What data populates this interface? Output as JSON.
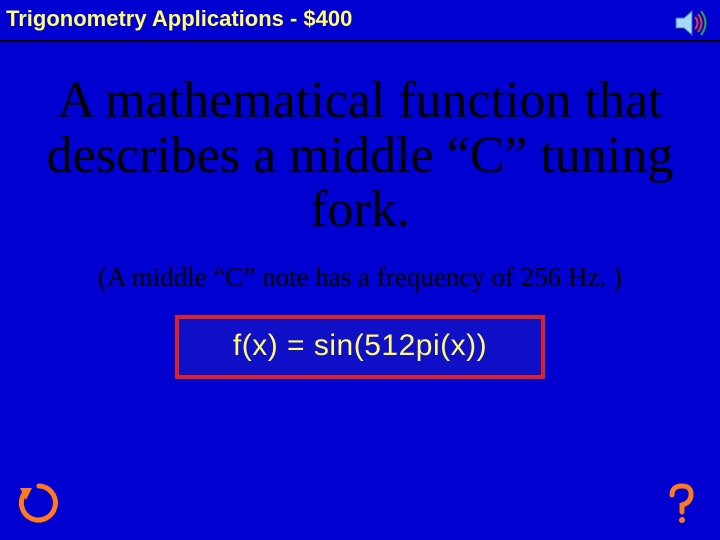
{
  "header": {
    "title": "Trigonometry Applications - $400"
  },
  "clue": {
    "main": "A mathematical function that describes a middle “C” tuning fork.",
    "sub": "(A middle “C” note has a frequency of 256 Hz. )"
  },
  "answer": {
    "text": "f(x) = sin(512pi(x))"
  },
  "icons": {
    "sound": "sound-icon",
    "back": "back-arrow-icon",
    "help": "question-mark-icon"
  },
  "colors": {
    "background": "#0000d0",
    "accent_text": "#fffd6b",
    "answer_border": "#d22222"
  }
}
